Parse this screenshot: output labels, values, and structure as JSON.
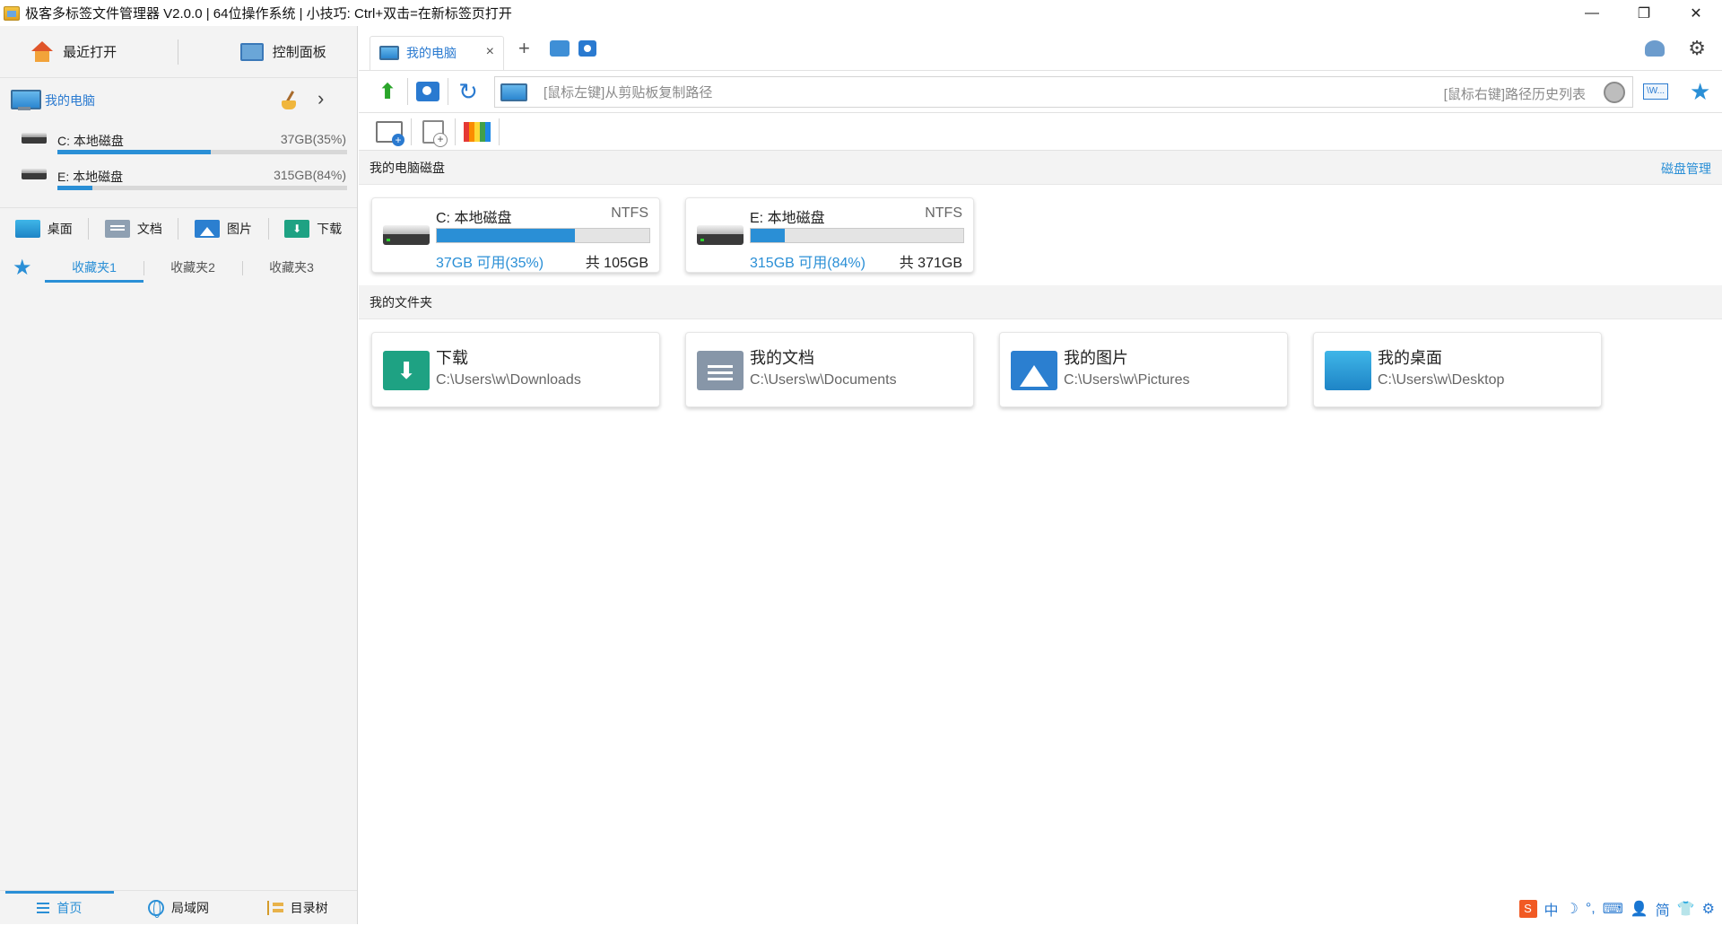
{
  "window": {
    "title": "极客多标签文件管理器 V2.0.0 | 64位操作系统 | 小技巧: Ctrl+双击=在新标签页打开",
    "minimize": "—",
    "restore": "❐",
    "close": "✕"
  },
  "sidebar": {
    "quick": [
      {
        "label": "最近打开",
        "icon": "house-icon"
      },
      {
        "label": "控制面板",
        "icon": "control-panel-icon"
      }
    ],
    "pc_label": "我的电脑",
    "drives": [
      {
        "name": "C: 本地磁盘",
        "size": "37GB(35%)",
        "free_pct": 0.53
      },
      {
        "name": "E: 本地磁盘",
        "size": "315GB(84%)",
        "free_pct": 0.12
      }
    ],
    "folders": [
      {
        "label": "桌面",
        "icon": "desktop-folder-icon"
      },
      {
        "label": "文档",
        "icon": "documents-folder-icon"
      },
      {
        "label": "图片",
        "icon": "pictures-folder-icon"
      },
      {
        "label": "下载",
        "icon": "downloads-folder-icon"
      }
    ],
    "favorites": [
      "收藏夹1",
      "收藏夹2",
      "收藏夹3"
    ],
    "bottom_tabs": [
      {
        "label": "首页",
        "icon": "list-icon"
      },
      {
        "label": "局域网",
        "icon": "globe-icon"
      },
      {
        "label": "目录树",
        "icon": "tree-icon"
      }
    ]
  },
  "tabs": {
    "active_label": "我的电脑",
    "close": "×",
    "add": "+"
  },
  "navbar": {
    "up": "⬆",
    "refresh": "↻",
    "address_placeholder": "[鼠标左键]从剪贴板复制路径",
    "address_hint": "[鼠标右键]路径历史列表",
    "terminal": "\\W..."
  },
  "main": {
    "drives_section": "我的电脑磁盘",
    "disk_manage": "磁盘管理",
    "drive_cards": [
      {
        "name": "C: 本地磁盘",
        "fs": "NTFS",
        "free": "37GB 可用(35%)",
        "total": "共 105GB",
        "used_fraction": 0.65
      },
      {
        "name": "E: 本地磁盘",
        "fs": "NTFS",
        "free": "315GB 可用(84%)",
        "total": "共 371GB",
        "used_fraction": 0.16
      }
    ],
    "folders_section": "我的文件夹",
    "folder_cards": [
      {
        "name": "下载",
        "path": "C:\\Users\\w\\Downloads",
        "icon": "downloads-folder-icon"
      },
      {
        "name": "我的文档",
        "path": "C:\\Users\\w\\Documents",
        "icon": "documents-folder-icon"
      },
      {
        "name": "我的图片",
        "path": "C:\\Users\\w\\Pictures",
        "icon": "pictures-folder-icon"
      },
      {
        "name": "我的桌面",
        "path": "C:\\Users\\w\\Desktop",
        "icon": "desktop-folder-icon"
      }
    ]
  },
  "ime": {
    "logo": "S",
    "items": [
      "中",
      "☽",
      "°,",
      "⌨",
      "👤",
      "简",
      "👕",
      "⚙"
    ]
  }
}
